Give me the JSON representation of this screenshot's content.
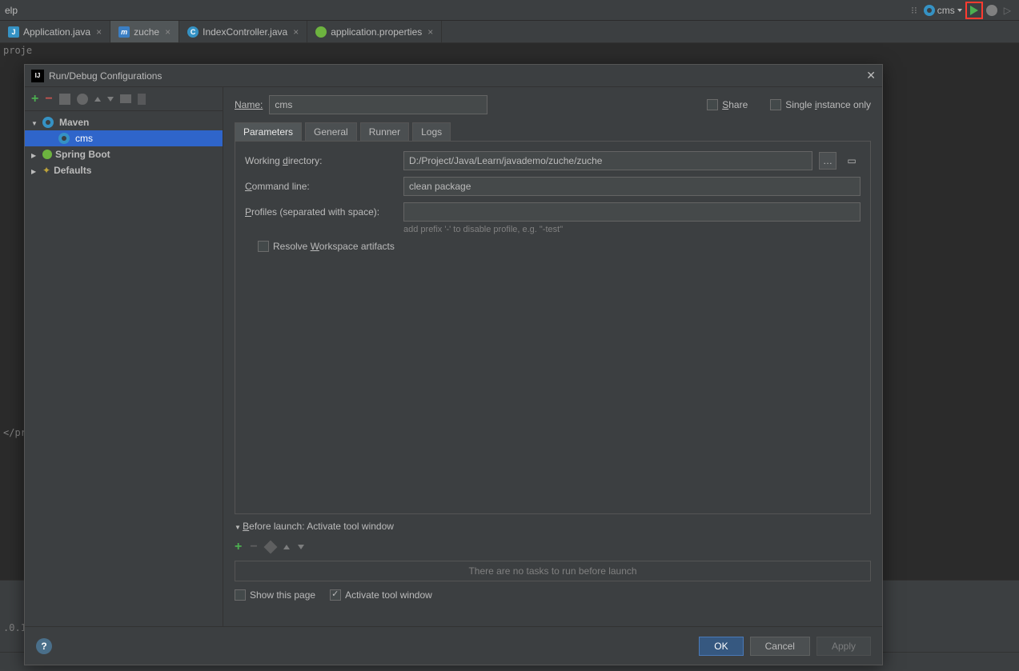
{
  "menu": {
    "help": "elp"
  },
  "toolbar": {
    "runConfig": "cms"
  },
  "editorTabs": [
    {
      "icon": "java",
      "label": "Application.java",
      "active": false
    },
    {
      "icon": "m",
      "label": "zuche",
      "active": true
    },
    {
      "icon": "c",
      "label": "IndexController.java",
      "active": false
    },
    {
      "icon": "spring",
      "label": "application.properties",
      "active": false
    }
  ],
  "background": {
    "line1": "proje",
    "line2": "</pro",
    "line3": ".0.1"
  },
  "dialog": {
    "title": "Run/Debug Configurations",
    "nameLabel": "Name:",
    "nameValue": "cms",
    "shareLabel": "Share",
    "singleInstanceLabel": "Single instance only",
    "tree": {
      "maven": "Maven",
      "cms": "cms",
      "springBoot": "Spring Boot",
      "defaults": "Defaults"
    },
    "tabs": [
      "Parameters",
      "General",
      "Runner",
      "Logs"
    ],
    "params": {
      "workingDirLabel": "Working directory:",
      "workingDirValue": "D:/Project/Java/Learn/javademo/zuche/zuche",
      "commandLineLabel": "Command line:",
      "commandLineValue": "clean package",
      "profilesLabel": "Profiles (separated with space):",
      "profilesValue": "",
      "profilesHint": "add prefix '-' to disable profile, e.g. \"-test\"",
      "resolveWorkspaceLabel": "Resolve Workspace artifacts"
    },
    "beforeLaunch": {
      "title": "Before launch: Activate tool window",
      "emptyText": "There are no tasks to run before launch",
      "showPageLabel": "Show this page",
      "activateToolLabel": "Activate tool window"
    },
    "footer": {
      "ok": "OK",
      "cancel": "Cancel",
      "apply": "Apply"
    }
  }
}
